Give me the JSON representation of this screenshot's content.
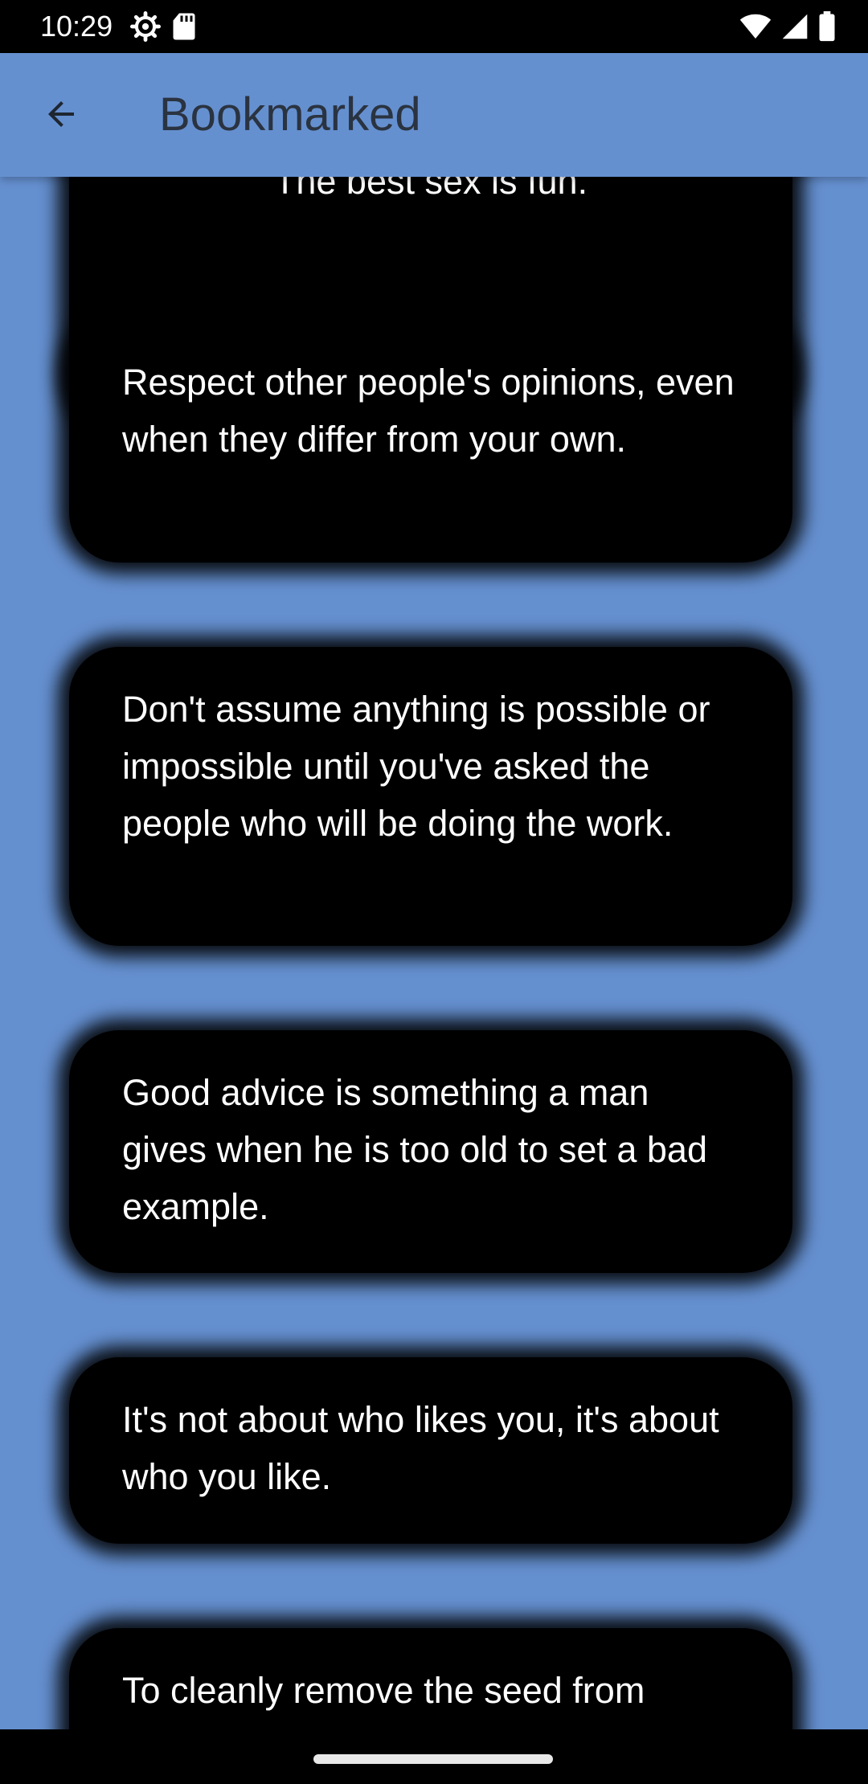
{
  "status_bar": {
    "time": "10:29",
    "left_icons": [
      "settings-gear-icon",
      "sd-card-icon"
    ],
    "right_icons": [
      "wifi-icon",
      "cell-signal-icon",
      "battery-icon"
    ]
  },
  "app_bar": {
    "back_icon": "arrow-back-icon",
    "title": "Bookmarked"
  },
  "quotes": [
    "The best sex is fun.",
    "Respect other people's opinions, even when they differ from your own.",
    "Don't assume anything is possible or impossible until you've asked the people who will be doing the work.",
    "Good advice is something a man gives when he is too old to set a bad example.",
    "It's not about who likes you, it's about who you like.",
    "To cleanly remove the seed from"
  ],
  "colors": {
    "background": "#6590D0",
    "card": "#000000",
    "card_text": "#FFFFFF",
    "title_text": "#2A3340"
  }
}
